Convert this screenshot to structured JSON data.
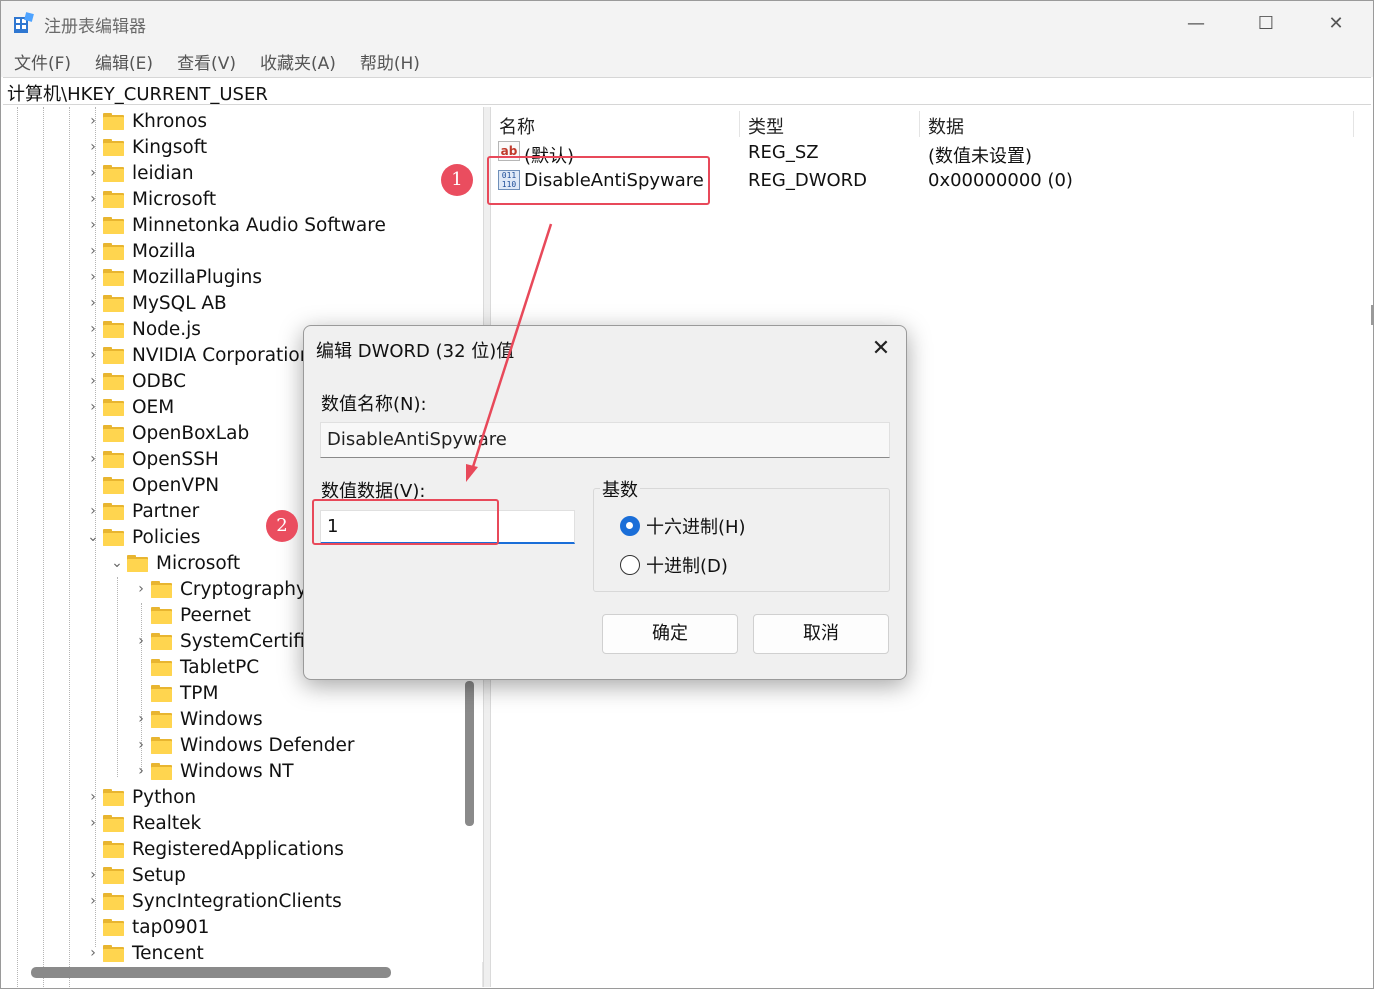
{
  "window": {
    "title": "注册表编辑器",
    "minimize": "—",
    "maximize": "☐",
    "close": "✕"
  },
  "menu": [
    "文件(F)",
    "编辑(E)",
    "查看(V)",
    "收藏夹(A)",
    "帮助(H)"
  ],
  "address": "计算机\\HKEY_CURRENT_USER",
  "tree": {
    "items": [
      {
        "label": "Khronos",
        "expander": "›"
      },
      {
        "label": "Kingsoft",
        "expander": "›"
      },
      {
        "label": "leidian",
        "expander": "›"
      },
      {
        "label": "Microsoft",
        "expander": "›"
      },
      {
        "label": "Minnetonka Audio Software",
        "expander": "›"
      },
      {
        "label": "Mozilla",
        "expander": "›"
      },
      {
        "label": "MozillaPlugins",
        "expander": "›"
      },
      {
        "label": "MySQL AB",
        "expander": "›"
      },
      {
        "label": "Node.js",
        "expander": "›"
      },
      {
        "label": "NVIDIA Corporation",
        "expander": "›"
      },
      {
        "label": "ODBC",
        "expander": "›"
      },
      {
        "label": "OEM",
        "expander": "›"
      },
      {
        "label": "OpenBoxLab",
        "expander": ""
      },
      {
        "label": "OpenSSH",
        "expander": "›"
      },
      {
        "label": "OpenVPN",
        "expander": ""
      },
      {
        "label": "Partner",
        "expander": "›"
      },
      {
        "label": "Policies",
        "expander": "⌄"
      },
      {
        "label": "Microsoft",
        "expander": "⌄"
      },
      {
        "label": "Cryptography",
        "expander": "›"
      },
      {
        "label": "Peernet",
        "expander": ""
      },
      {
        "label": "SystemCertific",
        "expander": "›"
      },
      {
        "label": "TabletPC",
        "expander": ""
      },
      {
        "label": "TPM",
        "expander": ""
      },
      {
        "label": "Windows",
        "expander": "›"
      },
      {
        "label": "Windows Defender",
        "expander": "›"
      },
      {
        "label": "Windows NT",
        "expander": "›"
      },
      {
        "label": "Python",
        "expander": "›"
      },
      {
        "label": "Realtek",
        "expander": "›"
      },
      {
        "label": "RegisteredApplications",
        "expander": ""
      },
      {
        "label": "Setup",
        "expander": "›"
      },
      {
        "label": "SyncIntegrationClients",
        "expander": "›"
      },
      {
        "label": "tap0901",
        "expander": ""
      },
      {
        "label": "Tencent",
        "expander": "›"
      }
    ]
  },
  "list": {
    "headers": {
      "name": "名称",
      "type": "类型",
      "data": "数据"
    },
    "rows": [
      {
        "icon": "string-value-icon",
        "icon_text": "ab",
        "name": "(默认)",
        "type": "REG_SZ",
        "data": "(数值未设置)"
      },
      {
        "icon": "binary-value-icon",
        "icon_text": "011 110",
        "name": "DisableAntiSpyware",
        "type": "REG_DWORD",
        "data": "0x00000000 (0)"
      }
    ]
  },
  "annotations": {
    "step1": "1",
    "step2": "2",
    "color": "#e8495a"
  },
  "dialog": {
    "title": "编辑 DWORD (32 位)值",
    "close": "✕",
    "name_label": "数值名称(N):",
    "name_value": "DisableAntiSpyware",
    "data_label": "数值数据(V):",
    "data_value": "1",
    "base_label": "基数",
    "hex_label": "十六进制(H)",
    "dec_label": "十进制(D)",
    "selected_base": "hex",
    "ok": "确定",
    "cancel": "取消"
  }
}
